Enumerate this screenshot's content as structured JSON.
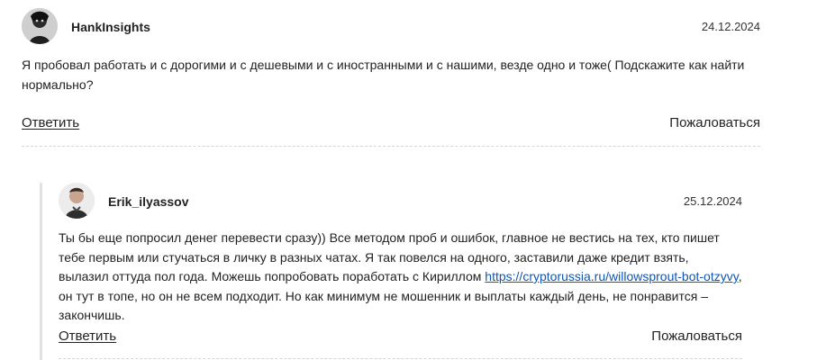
{
  "comments": [
    {
      "author": "HankInsights",
      "date": "24.12.2024",
      "avatar_icon": "user-avatar-icon",
      "text": "Я пробовал работать и с дорогими и с дешевыми и с иностранными и с нашими, везде одно и тоже( Подскажите как найти нормально?",
      "reply_label": "Ответить",
      "report_label": "Пожаловаться"
    },
    {
      "author": "Erik_ilyassov",
      "date": "25.12.2024",
      "avatar_icon": "user-avatar-icon",
      "text_before_link": "Ты бы еще попросил денег перевести сразу)) Все методом проб и ошибок, главное не вестись на тех, кто пишет тебе первым или стучаться в личку в разных чатах. Я так повелся на одного, заставили даже кредит взять, вылазил оттуда пол года. Можешь попробовать поработать с Кириллом ",
      "link_text": "https://cryptorussia.ru/willowsprout-bot-otzyvy",
      "text_after_link": ", он тут в топе, но он не всем подходит. Но как минимум не мошенник и выплаты каждый день, не понравится – закончишь.",
      "reply_label": "Ответить",
      "report_label": "Пожаловаться"
    }
  ],
  "colors": {
    "text": "#222222",
    "link": "#0b57b7",
    "divider": "#d5d5d5",
    "thread_line": "#e2e2e2"
  }
}
